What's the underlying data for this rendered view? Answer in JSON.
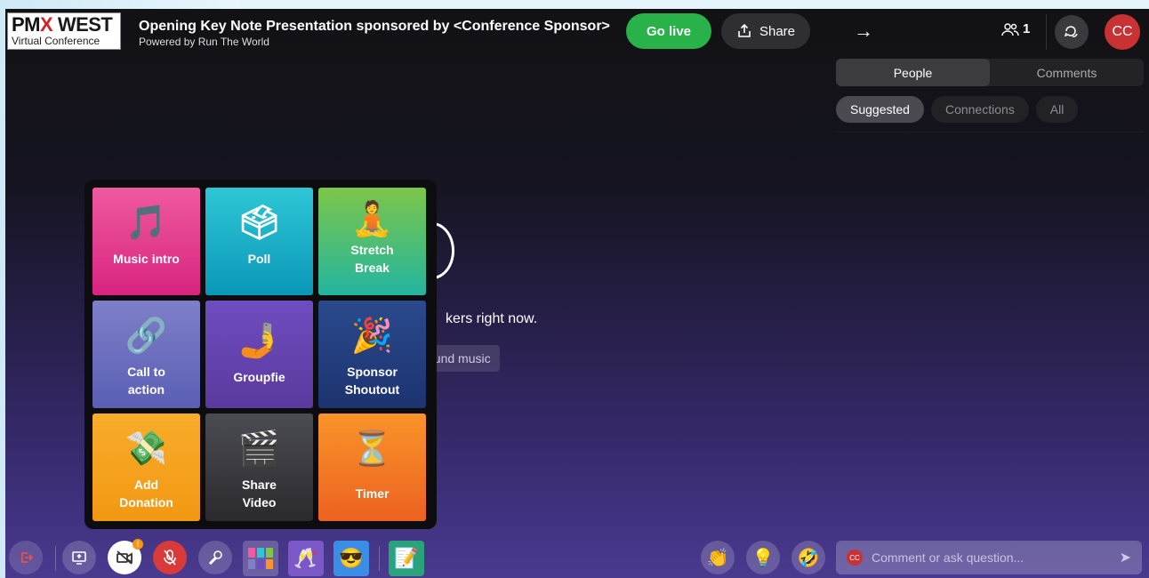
{
  "logo": {
    "main_left": "PM",
    "main_mid": "X",
    "main_right": "WEST",
    "sub": "Virtual Conference"
  },
  "header": {
    "title": "Opening Key Note Presentation sponsored by <Conference Sponsor>",
    "subtitle": "Powered by Run The World",
    "go_live_label": "Go live",
    "share_label": "Share",
    "people_count": "1",
    "avatar_initials": "CC"
  },
  "panel": {
    "tabs": [
      {
        "label": "People",
        "active": true
      },
      {
        "label": "Comments",
        "active": false
      }
    ],
    "chips": [
      {
        "label": "Suggested",
        "active": true
      },
      {
        "label": "Connections",
        "active": false
      },
      {
        "label": "All",
        "active": false
      }
    ]
  },
  "stage": {
    "message_fragment": "kers right now.",
    "music_fragment": "ound music"
  },
  "tiles": [
    {
      "label": "Music intro",
      "icon": "🎵",
      "icon_name": "music-note-icon"
    },
    {
      "label": "Poll",
      "icon": "🗳",
      "icon_name": "ballot-box-icon"
    },
    {
      "label": "Stretch Break",
      "icon": "🧘",
      "icon_name": "yoga-icon"
    },
    {
      "label": "Call to action",
      "icon": "🔗",
      "icon_name": "link-icon"
    },
    {
      "label": "Groupfie",
      "icon": "🤳",
      "icon_name": "selfie-icon"
    },
    {
      "label": "Sponsor Shoutout",
      "icon": "🎉",
      "icon_name": "party-popper-icon"
    },
    {
      "label": "Add Donation",
      "icon": "💸",
      "icon_name": "money-wings-icon"
    },
    {
      "label": "Share Video",
      "icon": "🎬",
      "icon_name": "clapper-icon"
    },
    {
      "label": "Timer",
      "icon": "⏳",
      "icon_name": "hourglass-icon"
    }
  ],
  "toolbar": {
    "camera_badge": "!",
    "reactions": [
      "👏",
      "💡",
      "🤣"
    ],
    "comment_placeholder": "Comment or ask question...",
    "comment_avatar": "CC"
  },
  "colors": {
    "go_live": "#29b24a",
    "avatar": "#c83232",
    "mic_off": "#d93a3a"
  }
}
